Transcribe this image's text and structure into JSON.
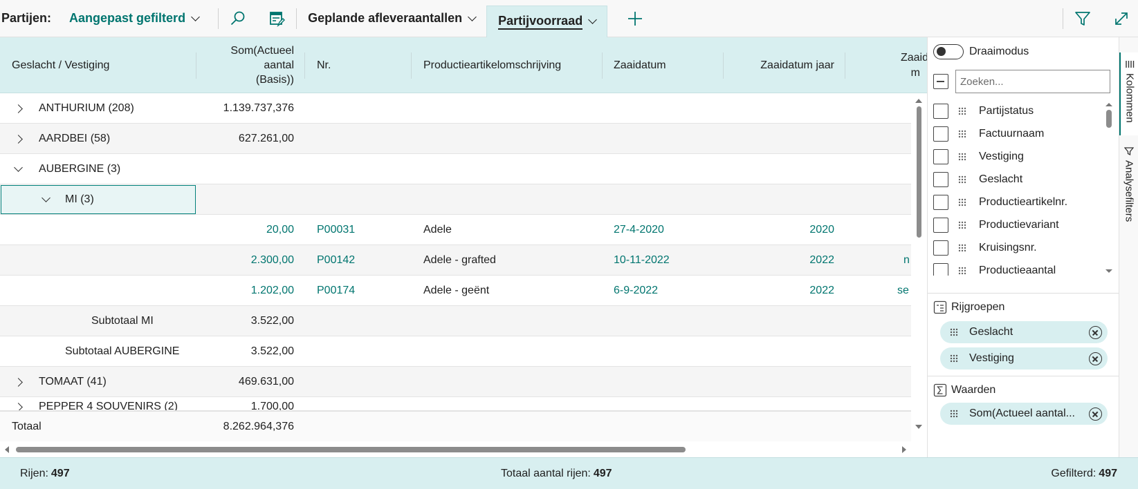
{
  "toolbar": {
    "label": "Partijen:",
    "filter": "Aangepast gefilterd",
    "views": [
      "Geplande afleveraantallen",
      "Partijvoorraad"
    ]
  },
  "grid": {
    "headers": {
      "group": "Geslacht / Vestiging",
      "sum": [
        "Som(Actueel",
        "aantal",
        "(Basis))"
      ],
      "nr": "Nr.",
      "desc": "Productieartikelomschrijving",
      "sowdate": "Zaaidatum",
      "sowyear": "Zaaidatum jaar",
      "sowmonth": [
        "Zaaid",
        "m"
      ]
    },
    "groups": [
      {
        "label": "ANTHURIUM (208)",
        "sum": "1.139.737,376",
        "expanded": false
      },
      {
        "label": "AARDBEI (58)",
        "sum": "627.261,00",
        "expanded": false
      },
      {
        "label": "AUBERGINE (3)",
        "sum": "",
        "expanded": true
      },
      {
        "label": "MI (3)",
        "sum": "",
        "expanded": true
      }
    ],
    "details": [
      {
        "sum": "20,00",
        "nr": "P00031",
        "desc": "Adele",
        "date": "27-4-2020",
        "year": "2020",
        "month": ""
      },
      {
        "sum": "2.300,00",
        "nr": "P00142",
        "desc": "Adele - grafted",
        "date": "10-11-2022",
        "year": "2022",
        "month": "n"
      },
      {
        "sum": "1.202,00",
        "nr": "P00174",
        "desc": "Adele - geënt",
        "date": "6-9-2022",
        "year": "2022",
        "month": "se"
      }
    ],
    "subtotals": [
      {
        "label": "Subtotaal MI",
        "sum": "3.522,00"
      },
      {
        "label": "Subtotaal AUBERGINE",
        "sum": "3.522,00"
      }
    ],
    "after": [
      {
        "label": "TOMAAT (41)",
        "sum": "469.631,00"
      },
      {
        "label": "PEPPER 4 SOUVENIRS (2)",
        "sum": "1.700,00"
      }
    ],
    "total": {
      "label": "Totaal",
      "sum": "8.262.964,376"
    }
  },
  "panel": {
    "pivot_label": "Draaimodus",
    "search_placeholder": "Zoeken...",
    "columns": [
      "Partijstatus",
      "Factuurnaam",
      "Vestiging",
      "Geslacht",
      "Productieartikelnr.",
      "Productievariant",
      "Kruisingsnr.",
      "Productieaantal"
    ],
    "row_groups_title": "Rijgroepen",
    "row_groups": [
      "Geslacht",
      "Vestiging"
    ],
    "values_title": "Waarden",
    "values": [
      "Som(Actueel aantal..."
    ]
  },
  "sidetabs": {
    "columns": "Kolommen",
    "filters": "Analysefilters"
  },
  "status": {
    "rows_label": "Rijen:",
    "rows": "497",
    "total_label": "Totaal aantal rijen:",
    "total": "497",
    "filtered_label": "Gefilterd:",
    "filtered": "497"
  },
  "colors": {
    "accent": "#00756f",
    "header_bg": "#d8eff0"
  }
}
